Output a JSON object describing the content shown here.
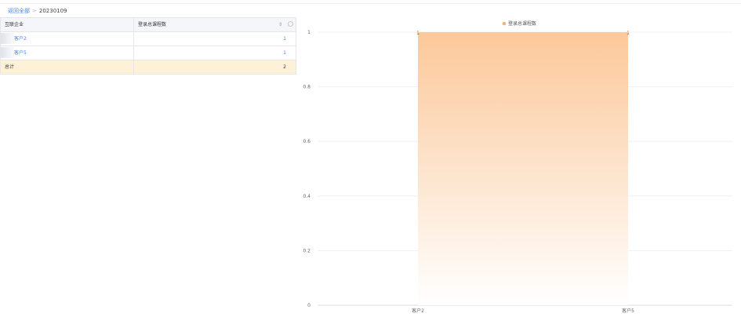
{
  "breadcrumb": {
    "back_label": "返回全部",
    "separator": ">",
    "current": "20230109"
  },
  "table": {
    "headers": [
      "互联企业",
      "登录总课程数"
    ],
    "rows": [
      {
        "name": "客户2",
        "value": "1"
      },
      {
        "name": "客户5",
        "value": "1"
      }
    ],
    "total": {
      "label": "总计",
      "value": "2"
    }
  },
  "icons": {
    "sort": "sort-icon",
    "settings": "settings-icon"
  },
  "chart_data": {
    "type": "bar",
    "categories": [
      "客户2",
      "客户5"
    ],
    "series": [
      {
        "name": "登录总课程数",
        "values": [
          1,
          1
        ]
      }
    ],
    "data_labels": [
      "1",
      "1"
    ],
    "yticks": [
      "0",
      "0.2",
      "0.4",
      "0.6",
      "0.8",
      "1"
    ],
    "ylim": [
      0,
      1
    ],
    "grid": true,
    "legend_position": "top-center",
    "colors": {
      "bar_top": "#fbc89a",
      "bar_bottom": "#ffffff",
      "legend_marker": "#f7b27a"
    }
  }
}
